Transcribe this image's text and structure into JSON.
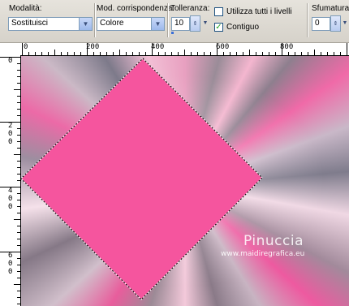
{
  "toolbar": {
    "mode": {
      "label": "Modalità:",
      "value": "Sostituisci"
    },
    "match_mode": {
      "label": "Mod. corrispondenza:",
      "value": "Colore"
    },
    "tolerance": {
      "label": "Tolleranza:",
      "value": "10"
    },
    "use_all_layers": {
      "label": "Utilizza tutti i livelli",
      "checked": false
    },
    "contiguous": {
      "label": "Contiguo",
      "checked": true
    },
    "feather": {
      "label": "Sfumatura:",
      "value": "0"
    }
  },
  "ruler_top": {
    "labels": [
      "0",
      "200",
      "400",
      "600",
      "800"
    ]
  },
  "ruler_left": {
    "labels": [
      "0",
      "2\n0\n0",
      "4\n0\n0",
      "6\n0\n0"
    ]
  },
  "canvas": {
    "shape_color": "#f5559e",
    "selection": "diamond marquee",
    "watermark_name": "Pinuccia",
    "watermark_url": "www.maidiregrafica.eu"
  }
}
